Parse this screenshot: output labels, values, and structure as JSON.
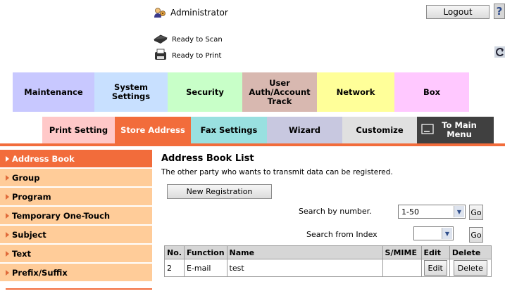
{
  "header": {
    "admin_label": "Administrator",
    "logout_label": "Logout",
    "help_label": "?",
    "scan_status": "Ready to Scan",
    "print_status": "Ready to Print"
  },
  "tabs_row1": [
    {
      "label": "Maintenance",
      "color": "#c8c8ff"
    },
    {
      "label": "System Settings",
      "color": "#c8e0ff"
    },
    {
      "label": "Security",
      "color": "#c8ffc8"
    },
    {
      "label": "User Auth/Account Track",
      "color": "#d8b8b0"
    },
    {
      "label": "Network",
      "color": "#ffff99"
    },
    {
      "label": "Box",
      "color": "#ffc8ff"
    }
  ],
  "tabs_row2": [
    {
      "label": "Print Setting",
      "color": "#ffc8c8"
    },
    {
      "label": "Store Address",
      "color": "#f26c3b"
    },
    {
      "label": "Fax Settings",
      "color": "#99e0e0"
    },
    {
      "label": "Wizard",
      "color": "#c8c8e0"
    },
    {
      "label": "Customize",
      "color": "#e0e0e0"
    },
    {
      "label": "To Main Menu",
      "color": "#404040"
    }
  ],
  "sidebar": {
    "items": [
      {
        "label": "Address Book",
        "active": true
      },
      {
        "label": "Group",
        "active": false
      },
      {
        "label": "Program",
        "active": false
      },
      {
        "label": "Temporary One-Touch",
        "active": false
      },
      {
        "label": "Subject",
        "active": false
      },
      {
        "label": "Text",
        "active": false
      },
      {
        "label": "Prefix/Suffix",
        "active": false
      }
    ]
  },
  "main": {
    "title": "Address Book List",
    "description": "The other party who wants to transmit data can be registered.",
    "new_registration_label": "New Registration",
    "search_by_number_label": "Search by number.",
    "search_by_number_value": "1-50",
    "search_from_index_label": "Search from Index",
    "search_from_index_value": "",
    "go_label": "Go",
    "table": {
      "headers": [
        "No.",
        "Function",
        "Name",
        "S/MIME",
        "Edit",
        "Delete"
      ],
      "rows": [
        {
          "no": "2",
          "function": "E-mail",
          "name": "test",
          "smime": "",
          "edit": "Edit",
          "delete": "Delete"
        }
      ]
    }
  },
  "colors": {
    "accent": "#f26c3b",
    "sidebar_bg": "#ffcc99"
  }
}
